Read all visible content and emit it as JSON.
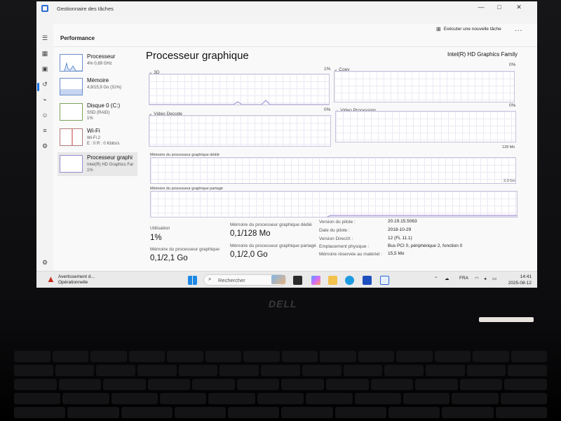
{
  "window": {
    "title": "Gestionnaire des tâches",
    "controls": [
      "—",
      "□",
      "✕"
    ]
  },
  "header": {
    "section": "Performance",
    "new_task": "Exécuter une nouvelle tâche",
    "more": "..."
  },
  "sidebar": {
    "items": [
      {
        "name": "Processeur",
        "sub1": "4% 0,89 GHz",
        "sub2": ""
      },
      {
        "name": "Mémoire",
        "sub1": "4,9/15,9 Go (31%)",
        "sub2": ""
      },
      {
        "name": "Disque 0 (C:)",
        "sub1": "SSD (RAID)",
        "sub2": "1%"
      },
      {
        "name": "Wi-Fi",
        "sub1": "Wi-Fi 2",
        "sub2": "E : 0 R : 0 Kbits/s"
      },
      {
        "name": "Processeur graphi",
        "sub1": "Intel(R) HD Graphics Far",
        "sub2": "1%"
      }
    ]
  },
  "main": {
    "title": "Processeur graphique",
    "gpu_name": "Intel(R) HD Graphics Family",
    "graphs": {
      "g3d": {
        "label": "3D",
        "pct": "1%"
      },
      "copy": {
        "label": "Copy",
        "pct": "0%"
      },
      "video_decode": {
        "label": "Video Decode",
        "pct": "0%"
      },
      "video_processing": {
        "label": "Video Processing",
        "pct": "0%"
      },
      "dedicated": {
        "label": "Mémoire du processeur graphique dédié",
        "max": "128 Mo"
      },
      "shared": {
        "label": "Mémoire du processeur graphique partagé",
        "max": "2,0 Go"
      }
    },
    "stats": {
      "utilisation_label": "Utilisation",
      "utilisation_value": "1%",
      "dedicated_label": "Mémoire du processeur graphique dédié",
      "dedicated_value": "0,1/128 Mo",
      "gpu_mem_label": "Mémoire du processeur graphique",
      "gpu_mem_value": "0,1/2,1 Go",
      "shared_label": "Mémoire du processeur graphique partagé",
      "shared_value": "0,1/2,0 Go"
    },
    "properties": [
      {
        "label": "Version du pilote :",
        "value": "20.19.15.5063"
      },
      {
        "label": "Date du pilote :",
        "value": "2018-10-29"
      },
      {
        "label": "Version DirectX :",
        "value": "12 (FL 11.1)"
      },
      {
        "label": "Emplacement physique :",
        "value": "Bus PCI 0, périphérique 2, fonction 0"
      },
      {
        "label": "Mémoire réservée au matériel :",
        "value": "15,5 Mo"
      }
    ]
  },
  "taskbar": {
    "warning_title": "Avertissement d...",
    "warning_sub": "Opérationnelle",
    "search_placeholder": "Rechercher",
    "language": "FRA",
    "time": "14:41",
    "date": "2025-08-12"
  },
  "brand": "DELL",
  "colors": {
    "accent": "#1a73e8",
    "graph_line": "#9b8ad0",
    "warning": "#c42b1c"
  }
}
